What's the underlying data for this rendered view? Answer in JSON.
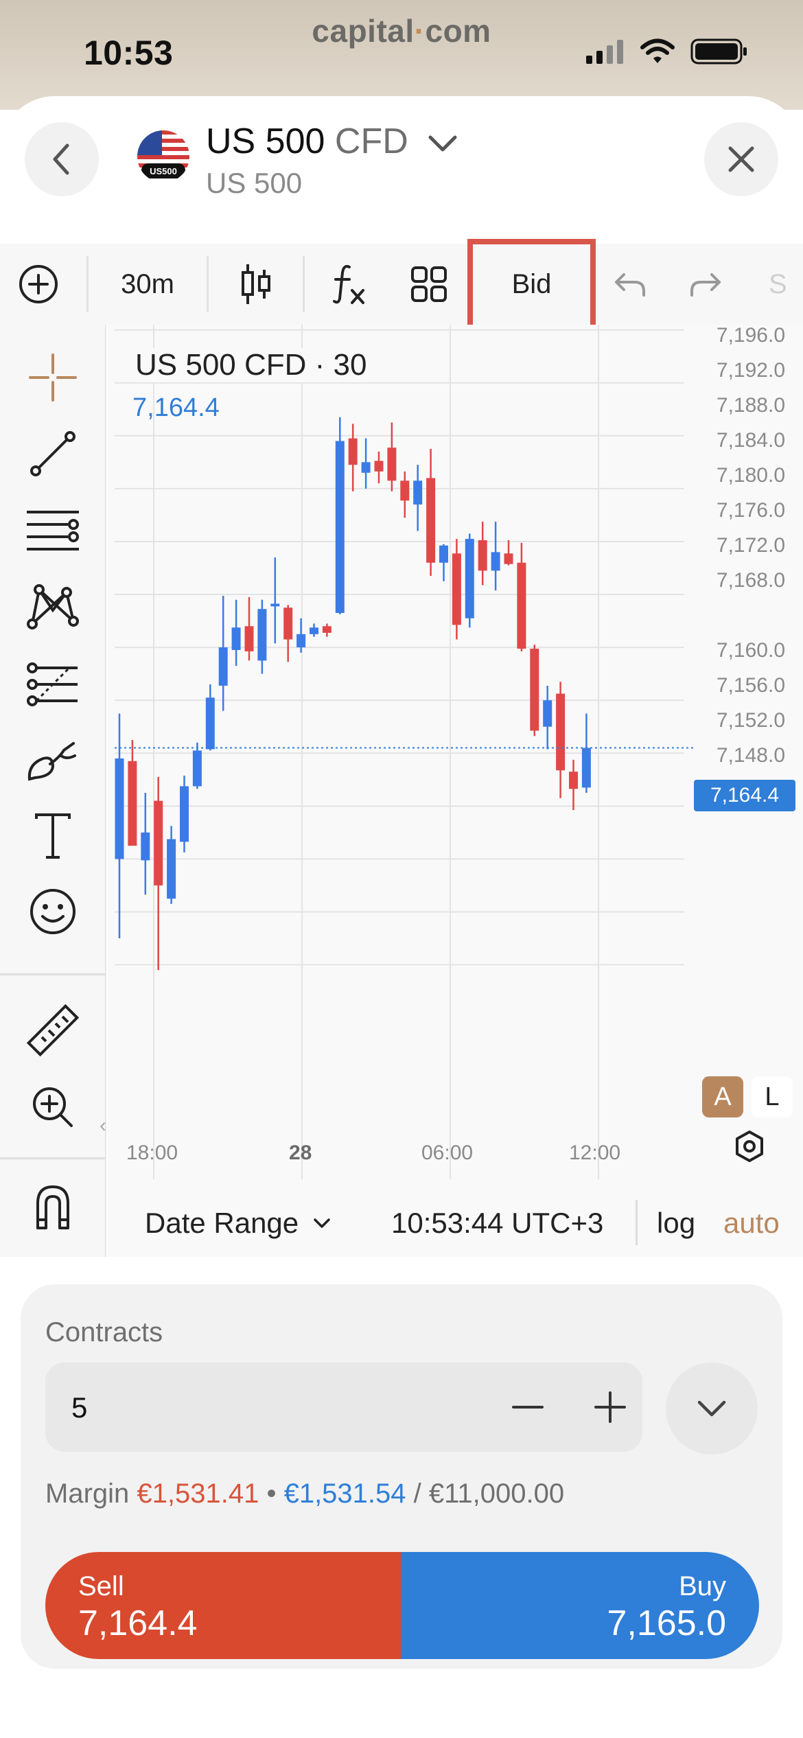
{
  "status_bar": {
    "time": "10:53",
    "brand_left": "capital",
    "brand_dot": "·",
    "brand_right": "com",
    "icons": [
      "cellular-signal-icon",
      "wifi-icon",
      "battery-icon"
    ]
  },
  "header": {
    "flag_label": "US500",
    "instrument": "US 500",
    "instrument_type": "CFD",
    "subtitle": "US 500",
    "icons": [
      "back-arrow-icon",
      "chevron-down-icon",
      "close-icon"
    ]
  },
  "toolbar": {
    "interval": "30m",
    "price_type": "Bid",
    "overflow_text": "S",
    "icons": [
      "add-circle-icon",
      "candlestick-icon",
      "indicators-fx-icon",
      "layout-grid-icon",
      "undo-icon",
      "redo-icon"
    ]
  },
  "left_tools": [
    "crosshair-icon",
    "trend-line-icon",
    "horizontal-lines-icon",
    "pattern-icon",
    "fib-tools-icon",
    "brush-icon",
    "text-tool-icon",
    "emoji-icon",
    "ruler-icon",
    "zoom-in-icon",
    "magnet-icon"
  ],
  "chart": {
    "legend_title": "US 500 CFD · 30",
    "legend_price": "7,164.4",
    "current_price_label": "7,164.4",
    "y_ticks": [
      "7,196.0",
      "7,192.0",
      "7,188.0",
      "7,184.0",
      "7,180.0",
      "7,176.0",
      "7,172.0",
      "7,168.0",
      "7,160.0",
      "7,156.0",
      "7,152.0",
      "7,148.0"
    ],
    "x_ticks": [
      "18:00",
      "28",
      "06:00",
      "12:00"
    ],
    "auto_button": "A",
    "log_button": "L",
    "up_color": "#3b7be6",
    "down_color": "#e04848"
  },
  "chart_bottom": {
    "date_range": "Date Range",
    "clock": "10:53:44 UTC+3",
    "log": "log",
    "auto": "auto"
  },
  "chart_data": {
    "type": "candlestick",
    "title": "US 500 CFD · 30",
    "xlabel": "",
    "ylabel": "",
    "x_tick_labels": [
      "18:00",
      "28",
      "06:00",
      "12:00"
    ],
    "ylim": [
      7144.5,
      7196.5
    ],
    "last_price": 7164.4,
    "candles": [
      {
        "o": 7156.0,
        "h": 7167.0,
        "l": 7150.0,
        "c": 7163.6
      },
      {
        "o": 7163.4,
        "h": 7165.0,
        "l": 7157.8,
        "c": 7157.0
      },
      {
        "o": 7155.9,
        "h": 7161.0,
        "l": 7153.3,
        "c": 7158.0
      },
      {
        "o": 7160.4,
        "h": 7162.2,
        "l": 7147.6,
        "c": 7154.0
      },
      {
        "o": 7153.0,
        "h": 7158.5,
        "l": 7152.6,
        "c": 7157.5
      },
      {
        "o": 7157.3,
        "h": 7162.3,
        "l": 7156.5,
        "c": 7161.5
      },
      {
        "o": 7161.5,
        "h": 7164.8,
        "l": 7161.3,
        "c": 7164.2
      },
      {
        "o": 7164.3,
        "h": 7169.2,
        "l": 7164.2,
        "c": 7168.2
      },
      {
        "o": 7169.1,
        "h": 7175.9,
        "l": 7167.2,
        "c": 7172.0
      },
      {
        "o": 7171.8,
        "h": 7175.6,
        "l": 7170.6,
        "c": 7173.5
      },
      {
        "o": 7173.6,
        "h": 7175.8,
        "l": 7171.0,
        "c": 7171.7
      },
      {
        "o": 7171.0,
        "h": 7175.6,
        "l": 7170.0,
        "c": 7174.9
      },
      {
        "o": 7175.1,
        "h": 7178.8,
        "l": 7172.3,
        "c": 7175.3
      },
      {
        "o": 7175.0,
        "h": 7175.2,
        "l": 7170.9,
        "c": 7172.6
      },
      {
        "o": 7172.0,
        "h": 7174.2,
        "l": 7171.6,
        "c": 7173.0
      },
      {
        "o": 7173.0,
        "h": 7173.8,
        "l": 7172.8,
        "c": 7173.5
      },
      {
        "o": 7173.6,
        "h": 7173.8,
        "l": 7172.8,
        "c": 7173.1
      },
      {
        "o": 7174.6,
        "h": 7189.4,
        "l": 7174.5,
        "c": 7187.6
      },
      {
        "o": 7187.8,
        "h": 7188.9,
        "l": 7183.8,
        "c": 7185.8
      },
      {
        "o": 7185.2,
        "h": 7187.8,
        "l": 7184.0,
        "c": 7186.0
      },
      {
        "o": 7186.1,
        "h": 7186.8,
        "l": 7184.4,
        "c": 7185.3
      },
      {
        "o": 7187.1,
        "h": 7189.0,
        "l": 7183.8,
        "c": 7184.6
      },
      {
        "o": 7184.6,
        "h": 7185.3,
        "l": 7181.8,
        "c": 7183.1
      },
      {
        "o": 7182.8,
        "h": 7185.8,
        "l": 7180.8,
        "c": 7184.6
      },
      {
        "o": 7184.8,
        "h": 7187.0,
        "l": 7177.4,
        "c": 7178.4
      },
      {
        "o": 7178.4,
        "h": 7179.8,
        "l": 7177.0,
        "c": 7179.7
      },
      {
        "o": 7179.1,
        "h": 7180.2,
        "l": 7172.6,
        "c": 7173.7
      },
      {
        "o": 7174.2,
        "h": 7180.6,
        "l": 7173.5,
        "c": 7180.2
      },
      {
        "o": 7180.1,
        "h": 7181.5,
        "l": 7176.7,
        "c": 7177.8
      },
      {
        "o": 7177.8,
        "h": 7181.5,
        "l": 7176.3,
        "c": 7179.2
      },
      {
        "o": 7179.1,
        "h": 7180.1,
        "l": 7178.2,
        "c": 7178.3
      },
      {
        "o": 7178.4,
        "h": 7179.9,
        "l": 7171.7,
        "c": 7171.9
      },
      {
        "o": 7171.9,
        "h": 7172.2,
        "l": 7165.3,
        "c": 7165.7
      },
      {
        "o": 7166.0,
        "h": 7169.1,
        "l": 7164.3,
        "c": 7168.0
      },
      {
        "o": 7168.5,
        "h": 7169.4,
        "l": 7160.6,
        "c": 7162.7
      },
      {
        "o": 7162.6,
        "h": 7163.5,
        "l": 7159.7,
        "c": 7161.3
      },
      {
        "o": 7161.4,
        "h": 7167.0,
        "l": 7161.0,
        "c": 7164.4
      }
    ]
  },
  "order": {
    "contracts_label": "Contracts",
    "quantity": "5",
    "margin_label": "Margin",
    "margin_sell": "€1,531.41",
    "margin_sep": " • ",
    "margin_buy": "€1,531.54",
    "margin_total": " / €11,000.00",
    "sell_label": "Sell",
    "sell_price": "7,164.4",
    "buy_label": "Buy",
    "buy_price": "7,165.0",
    "sell_color": "#d8492e",
    "buy_color": "#2f7ed8"
  }
}
